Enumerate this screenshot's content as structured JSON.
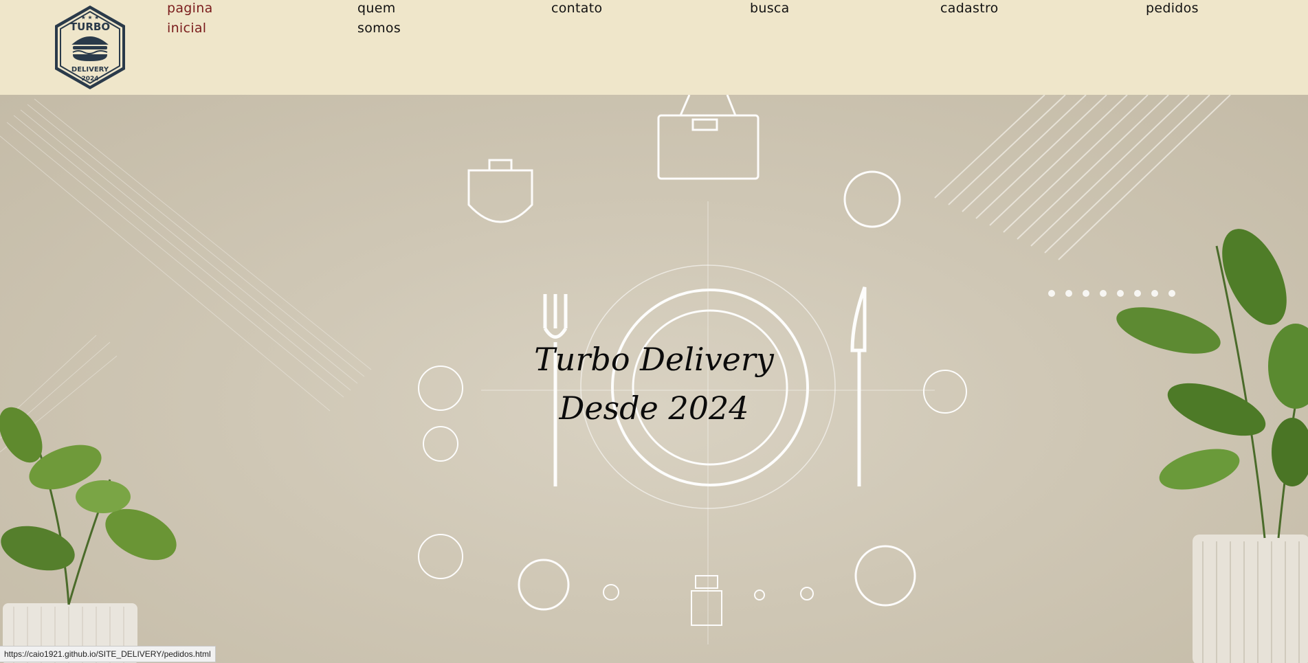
{
  "logo": {
    "top_text": "TURBO",
    "middle_text": "DELIVERY",
    "year": "2024",
    "icon": "burger-icon"
  },
  "nav": [
    {
      "line1": "pagina",
      "line2": "inicial",
      "active": true
    },
    {
      "line1": "quem",
      "line2": "somos",
      "active": false
    },
    {
      "line1": "contato",
      "line2": "",
      "active": false
    },
    {
      "line1": "busca",
      "line2": "",
      "active": false
    },
    {
      "line1": "cadastro",
      "line2": "",
      "active": false
    },
    {
      "line1": "pedidos",
      "line2": "",
      "active": false
    }
  ],
  "hero": {
    "line1": "Turbo Delivery",
    "line2": "Desde 2024"
  },
  "status_bar": {
    "url": "https://caio1921.github.io/SITE_DELIVERY/pedidos.html"
  },
  "colors": {
    "header_bg": "#efe6ca",
    "active_link": "#7a1c1c",
    "logo_navy": "#2a3a4a"
  }
}
